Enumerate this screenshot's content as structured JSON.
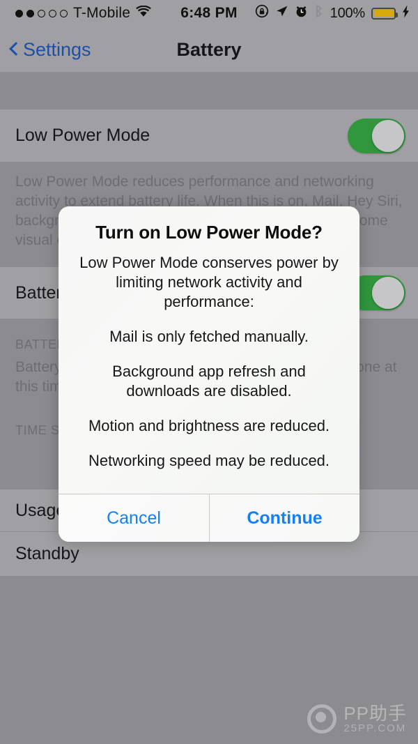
{
  "status_bar": {
    "signal_dots_filled": 2,
    "signal_dots_total": 5,
    "carrier": "T-Mobile",
    "wifi_icon": "wifi-icon",
    "time": "6:48 PM",
    "icons": [
      "rotation-lock-icon",
      "location-arrow-icon",
      "alarm-clock-icon",
      "bluetooth-icon"
    ],
    "battery_percent": "100%",
    "battery_fill_color": "#d8a90b",
    "charging_icon": "lightning-bolt-icon"
  },
  "nav_bar": {
    "back_label": "Settings",
    "back_icon": "chevron-left-icon",
    "title": "Battery",
    "accent_color": "#1c4fa8"
  },
  "settings": {
    "rows": [
      {
        "label": "Low Power Mode",
        "toggle": "on"
      },
      {
        "label": "Battery Percentage",
        "toggle": "on"
      }
    ],
    "low_power_footer": "Low Power Mode reduces performance and networking activity to extend battery life.  When this is on, Mail, Hey Siri, background app refresh, automatic downloads, and some visual effects are reduced or turned off.",
    "battery_usage_header": "BATTERY USAGE",
    "battery_usage_note": "Battery usage information is not available for this iPhone at this time.",
    "time_since_header": "TIME SINCE LAST FULL CHARGE",
    "usage_label": "Usage",
    "standby_label": "Standby",
    "toggle_on_color": "#31973d"
  },
  "alert": {
    "title": "Turn on Low Power Mode?",
    "paragraphs": [
      "Low Power Mode conserves power by limiting network activity and performance:",
      "Mail is only fetched manually.",
      "Background app refresh and downloads are disabled.",
      "Motion and brightness are reduced.",
      "Networking speed may be reduced."
    ],
    "cancel_label": "Cancel",
    "continue_label": "Continue",
    "button_color": "#1580f4"
  },
  "watermark": {
    "logo_icon": "pp-assistant-logo-icon",
    "main": "PP助手",
    "sub": "25PP.COM"
  }
}
